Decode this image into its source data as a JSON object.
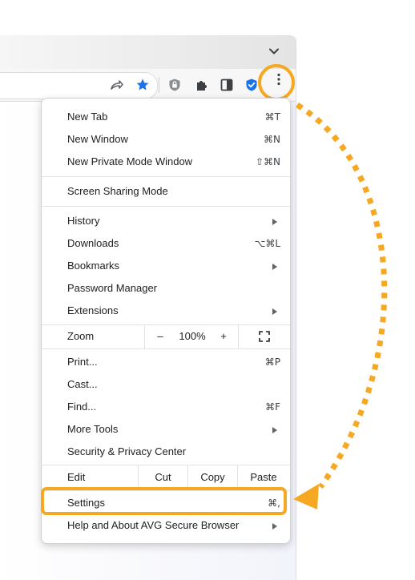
{
  "colors": {
    "highlight": "#f7a823",
    "star": "#1a73e8",
    "shield": "#1a73e8"
  },
  "toolbar_icons": [
    "share-icon",
    "bookmark-star-icon",
    "lock-shield-icon",
    "extensions-icon",
    "side-panel-icon",
    "avg-shield-icon",
    "more-options-icon"
  ],
  "menu": {
    "new_tab": {
      "label": "New Tab",
      "shortcut": "⌘T"
    },
    "new_window": {
      "label": "New Window",
      "shortcut": "⌘N"
    },
    "new_private": {
      "label": "New Private Mode Window",
      "shortcut": "⇧⌘N"
    },
    "screen_sharing": {
      "label": "Screen Sharing Mode"
    },
    "history": {
      "label": "History"
    },
    "downloads": {
      "label": "Downloads",
      "shortcut": "⌥⌘L"
    },
    "bookmarks": {
      "label": "Bookmarks"
    },
    "password_manager": {
      "label": "Password Manager"
    },
    "extensions": {
      "label": "Extensions"
    },
    "zoom": {
      "label": "Zoom",
      "minus": "–",
      "value": "100%",
      "plus": "+"
    },
    "print": {
      "label": "Print...",
      "shortcut": "⌘P"
    },
    "cast": {
      "label": "Cast..."
    },
    "find": {
      "label": "Find...",
      "shortcut": "⌘F"
    },
    "more_tools": {
      "label": "More Tools"
    },
    "security_center": {
      "label": "Security & Privacy Center"
    },
    "edit": {
      "label": "Edit",
      "cut": "Cut",
      "copy": "Copy",
      "paste": "Paste"
    },
    "settings": {
      "label": "Settings",
      "shortcut": "⌘,"
    },
    "help": {
      "label": "Help and About AVG Secure Browser"
    }
  }
}
